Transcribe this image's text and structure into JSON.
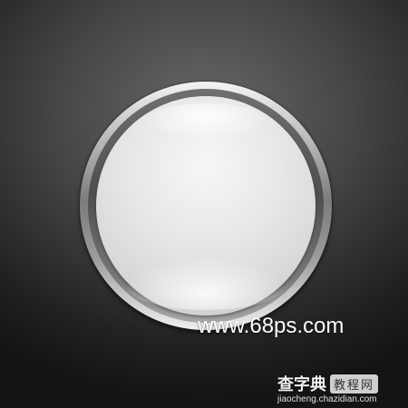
{
  "watermark": {
    "site": "www.68ps.com"
  },
  "brand": {
    "name": "查字典",
    "tag": "教程网",
    "url": "jiaocheng.chazidian.com"
  },
  "colors": {
    "background_dark": "#141414",
    "background_light": "#686868",
    "dome": "#e8e8e8",
    "text": "#ffffff"
  }
}
